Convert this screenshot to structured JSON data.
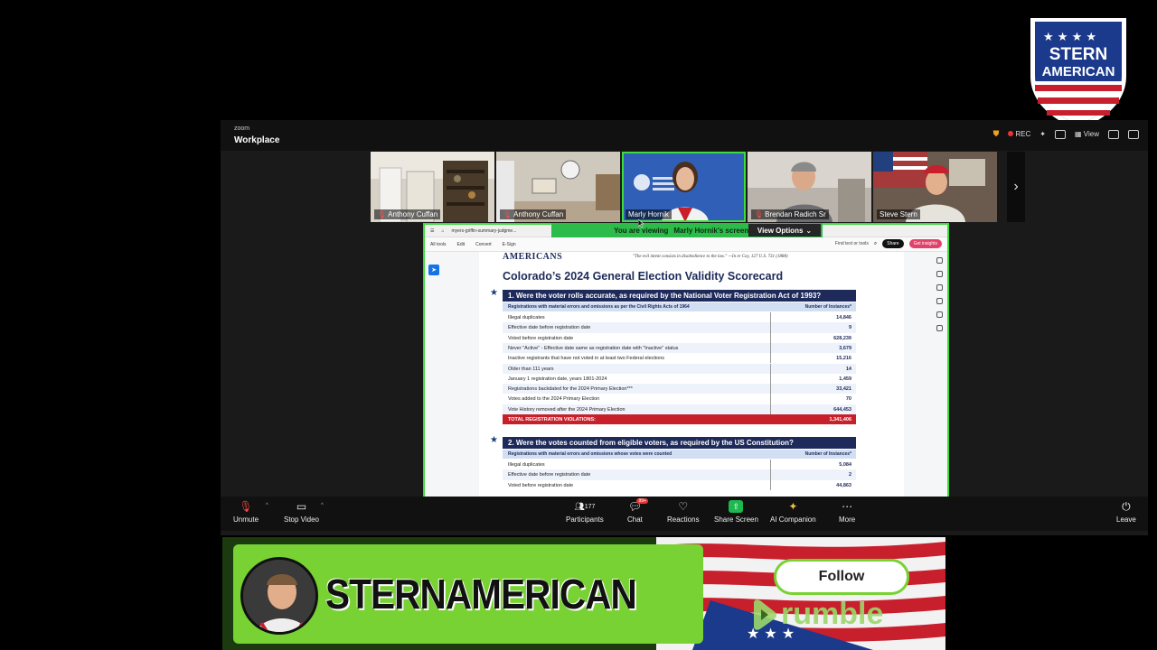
{
  "zoom": {
    "brand_small": "zoom",
    "brand_large": "Workplace",
    "rec_label": "REC",
    "view_label": "View"
  },
  "logo": {
    "line1": "STERN",
    "line2": "AMERICAN"
  },
  "participants": [
    {
      "name": "Anthony Cuffan",
      "muted": true
    },
    {
      "name": "Anthony Cuffan",
      "muted": true
    },
    {
      "name": "Marly Hornik",
      "muted": false,
      "active": true
    },
    {
      "name": "Brendan Radich Sr",
      "muted": true
    },
    {
      "name": "Steve Stern",
      "muted": true
    }
  ],
  "viewing": {
    "prefix": "You are viewing",
    "name": "Marly Hornik's screen",
    "view_options": "View Options"
  },
  "acrobat": {
    "tab_title": "myers-griffin-summary-judgme...",
    "tabs": [
      "All tools",
      "Edit",
      "Convert",
      "E-Sign"
    ],
    "find": "Find text or tools",
    "share": "Share",
    "insights": "Get insights"
  },
  "document": {
    "brand": "AMERICANS",
    "quote": "\"The evil intent consists in disobedience to the law.\" —In re Coy, 127 U.S. 731 (1888)",
    "title": "Colorado’s 2024 General Election Validity Scorecard",
    "q1": {
      "heading": "1. Were the voter rolls accurate, as required by the National Voter Registration Act of 1993?",
      "col1": "Registrations with material errors and omissions as per the Civil Rights Acts of 1964",
      "col2": "Number of Instances*",
      "rows": [
        {
          "label": "Illegal duplicates",
          "value": "14,846"
        },
        {
          "label": "Effective date before registration date",
          "value": "9"
        },
        {
          "label": "Voted before registration date",
          "value": "628,239"
        },
        {
          "label": "Never \"Active\" - Effective date same as registration date with \"Inactive\" status",
          "value": "3,679"
        },
        {
          "label": "Inactive registrants that have not voted in at least two Federal elections",
          "value": "15,216"
        },
        {
          "label": "Older than 111 years",
          "value": "14"
        },
        {
          "label": "January 1 registration date, years 1801-2024",
          "value": "1,459"
        },
        {
          "label": "Registrations backdated  for the 2024 Primary Election***",
          "value": "33,421"
        },
        {
          "label": "Votes added to the 2024 Primary Election",
          "value": "70"
        },
        {
          "label": "Vote History removed after the 2024 Primary Election",
          "value": "644,453"
        }
      ],
      "total_label": "TOTAL REGISTRATION VIOLATIONS:",
      "total_value": "1,341,406"
    },
    "q2": {
      "heading": "2. Were the votes counted from eligible voters, as required by the US Constitution?",
      "col1": "Registrations with material errors and omissions whose votes were counted",
      "col2": "Number of Instances*",
      "rows": [
        {
          "label": "Illegal duplicates",
          "value": "5,084"
        },
        {
          "label": "Effective date before registration date",
          "value": "2"
        },
        {
          "label": "Voted before registration date",
          "value": "44,863"
        }
      ]
    }
  },
  "toolbar": {
    "unmute": "Unmute",
    "stop_video": "Stop Video",
    "participants": "Participants",
    "participants_count": "177",
    "chat": "Chat",
    "chat_badge": "99+",
    "reactions": "Reactions",
    "share_screen": "Share Screen",
    "ai_companion": "AI Companion",
    "more": "More",
    "leave": "Leave"
  },
  "banner": {
    "name": "STERNAMERICAN",
    "follow": "Follow",
    "platform": "rumble"
  }
}
